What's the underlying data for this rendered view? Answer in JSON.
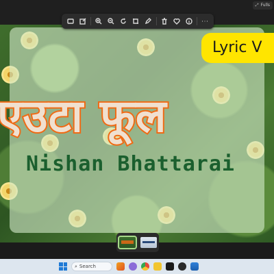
{
  "window": {
    "fullscreen_label": "Fulls"
  },
  "toolbar": {
    "icons": [
      "view-icon",
      "edit-icon",
      "zoom-in-icon",
      "zoom-out-icon",
      "rotate-icon",
      "crop-icon",
      "markup-icon",
      "delete-icon",
      "favorite-icon",
      "info-icon",
      "more-icon"
    ]
  },
  "image": {
    "badge": "Lyric V",
    "title": "एउटा फूल",
    "artist": "Nishan Bhattarai"
  },
  "filmstrip": {
    "thumbnails": [
      "current-image",
      "next-image"
    ]
  },
  "taskbar": {
    "search_label": "Search"
  },
  "colors": {
    "title_outline": "#f06a14",
    "badge": "#ffe500",
    "artist": "#1b5f2e",
    "taskbar": "#dde6ef"
  }
}
